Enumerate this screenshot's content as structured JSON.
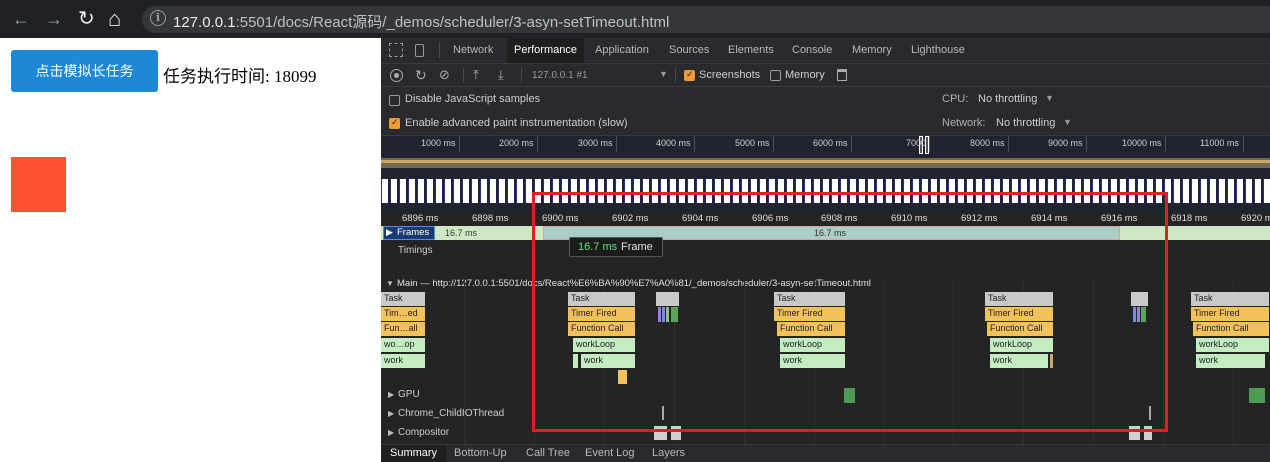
{
  "browser": {
    "back_icon": "←",
    "forward_icon": "→",
    "reload_icon": "↻",
    "home_icon": "⌂",
    "info_icon": "i",
    "url_host": "127.0.0.1",
    "url_rest": ":5501/docs/React源码/_demos/scheduler/3-asyn-setTimeout.html"
  },
  "page": {
    "button_label": "点击模拟长任务",
    "time_text": "任务执行时间: 18099",
    "square_color": "#ff5233"
  },
  "devtools": {
    "tabs": [
      "Network",
      "Performance",
      "Application",
      "Sources",
      "Elements",
      "Console",
      "Memory",
      "Lighthouse"
    ],
    "active_tab": "Performance",
    "toolbar": {
      "profile_select": "127.0.0.1 #1",
      "screenshots_label": "Screenshots",
      "memory_label": "Memory"
    },
    "settings": {
      "disable_js_samples": "Disable JavaScript samples",
      "advanced_paint": "Enable advanced paint instrumentation (slow)",
      "cpu_label": "CPU:",
      "cpu_value": "No throttling",
      "network_label": "Network:",
      "network_value": "No throttling"
    },
    "overview_ticks": [
      "1000 ms",
      "2000 ms",
      "3000 ms",
      "4000 ms",
      "5000 ms",
      "6000 ms",
      "7000",
      "8000 ms",
      "9000 ms",
      "10000 ms",
      "11000 ms"
    ],
    "ruler_ticks": [
      "6896 ms",
      "6898 ms",
      "6900 ms",
      "6902 ms",
      "6904 ms",
      "6906 ms",
      "6908 ms",
      "6910 ms",
      "6912 ms",
      "6914 ms",
      "6916 ms",
      "6918 ms",
      "6920 ms"
    ],
    "frames": {
      "label": "Frames",
      "left_value": "16.7 ms",
      "center_value": "16.7 ms"
    },
    "tooltip": {
      "duration": "16.7 ms",
      "kind": "Frame"
    },
    "timings_label": "Timings",
    "main_label": "Main — http://127.0.0.1:5501/docs/React%E6%BA%90%E7%A0%81/_demos/scheduler/3-asyn-setTimeout.html",
    "flame_left": [
      "Task",
      "Tim…ed",
      "Fun…all",
      "wo…op",
      "work"
    ],
    "flame_group": [
      "Task",
      "Timer Fired",
      "Function Call",
      "workLoop",
      "work"
    ],
    "threads": [
      "GPU",
      "Chrome_ChildIOThread",
      "Compositor"
    ],
    "bottom_tabs": [
      "Summary",
      "Bottom-Up",
      "Call Tree",
      "Event Log",
      "Layers"
    ],
    "active_bottom_tab": "Summary"
  },
  "colors": {
    "highlight_box": "#e02020",
    "button_bg": "#1f88d6",
    "task": "#c9c9c9",
    "scripting": "#f2c15a",
    "work": "#c3ecc0"
  }
}
